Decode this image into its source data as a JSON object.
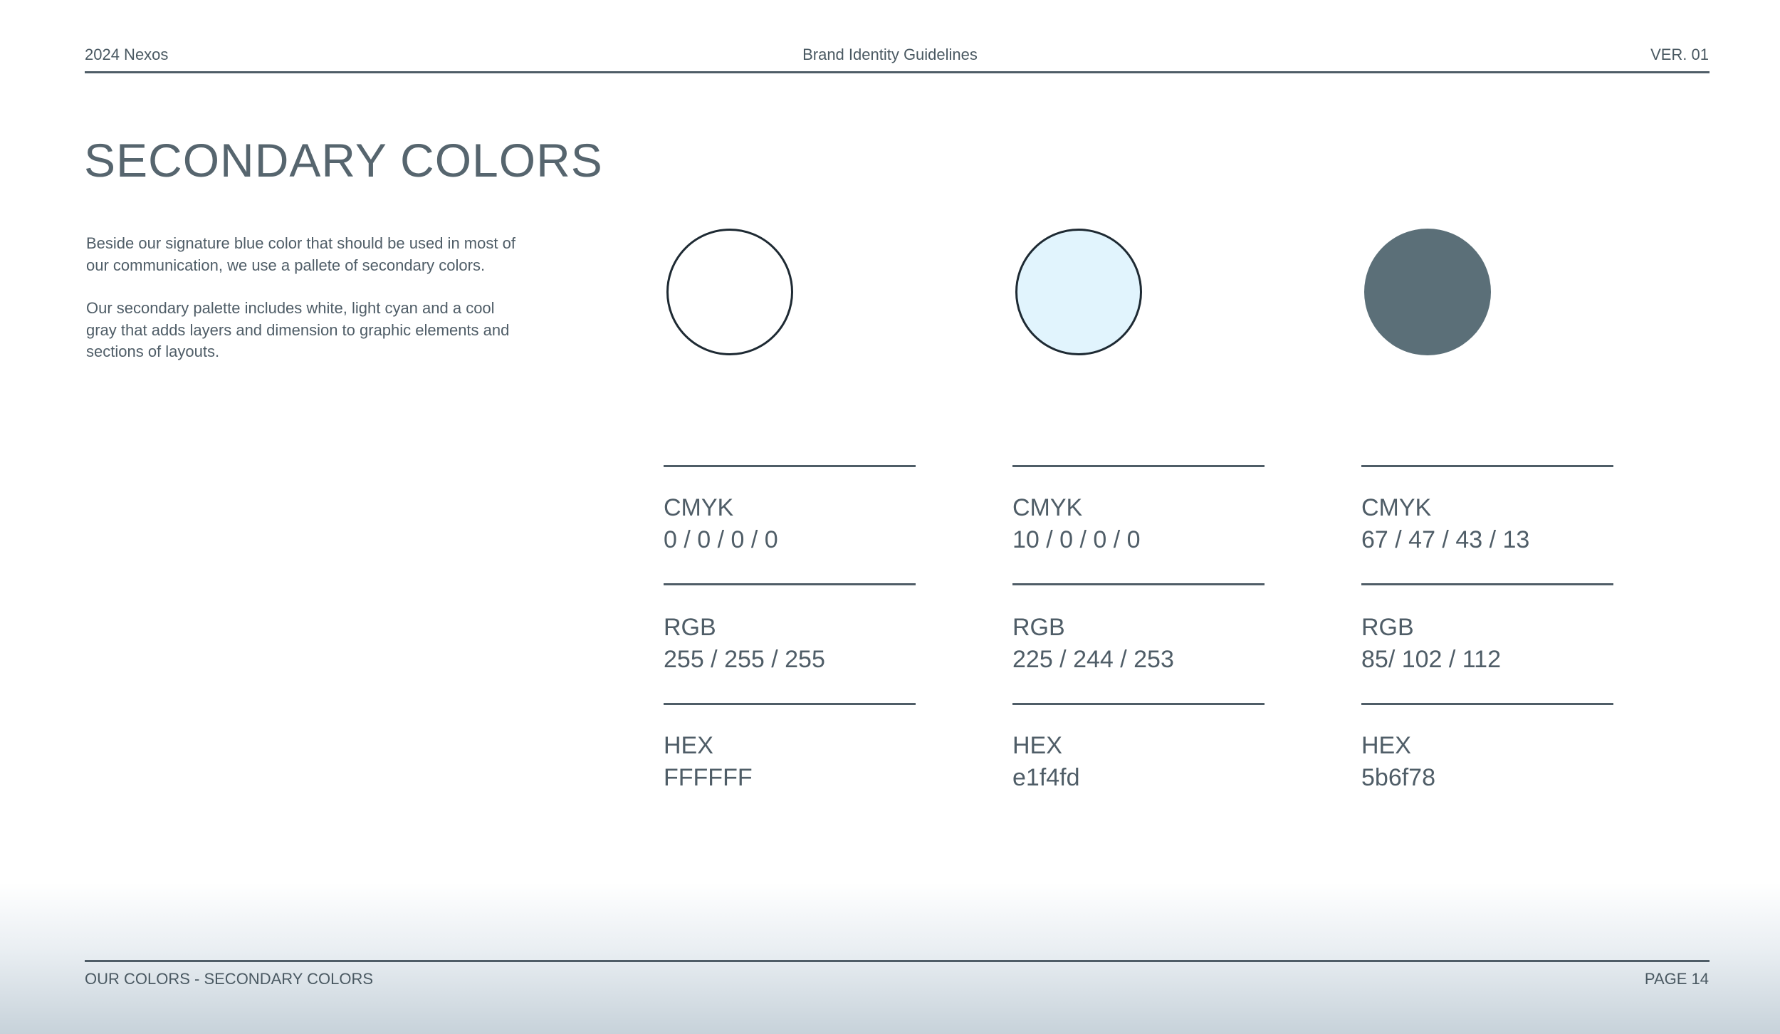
{
  "header": {
    "left": "2024 Nexos",
    "center": "Brand Identity Guidelines",
    "right": "VER. 01"
  },
  "title": "SECONDARY COLORS",
  "intro": {
    "paragraph1": "Beside our signature blue color that should be used in most of our communication, we use a pallete of secondary colors.",
    "paragraph2": "Our secondary palette includes white, light cyan and a cool gray that adds layers and dimension to graphic elements and sections of layouts."
  },
  "colors": [
    {
      "swatch_color": "#ffffff",
      "outlined": true,
      "cmyk_label": "CMYK",
      "cmyk": "0 / 0 / 0 / 0",
      "rgb_label": "RGB",
      "rgb": "255 / 255 / 255",
      "hex_label": "HEX",
      "hex": "FFFFFF"
    },
    {
      "swatch_color": "#e1f4fd",
      "outlined": true,
      "cmyk_label": "CMYK",
      "cmyk": "10 / 0 / 0 / 0",
      "rgb_label": "RGB",
      "rgb": "225 / 244 / 253",
      "hex_label": "HEX",
      "hex": "e1f4fd"
    },
    {
      "swatch_color": "#5b6f78",
      "outlined": false,
      "cmyk_label": "CMYK",
      "cmyk": "67 / 47 / 43 / 13",
      "rgb_label": "RGB",
      "rgb": "85/ 102 / 112",
      "hex_label": "HEX",
      "hex": "5b6f78"
    }
  ],
  "footer": {
    "left": "OUR COLORS - SECONDARY COLORS",
    "right": "PAGE 14"
  },
  "theme": {
    "text_color": "#4f5d67",
    "rule_color": "#4f5d67",
    "outline_color": "#1e2a33"
  }
}
